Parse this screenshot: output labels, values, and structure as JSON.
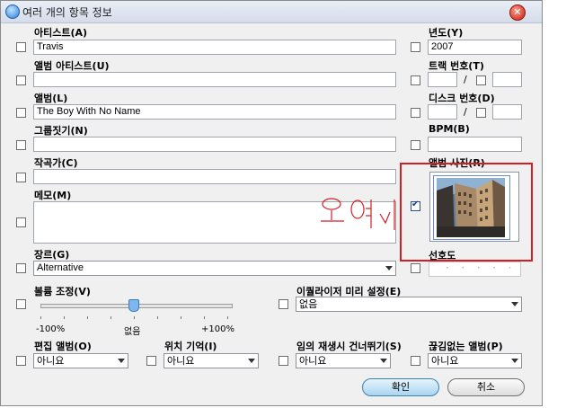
{
  "window": {
    "title": "여러 개의 항목 정보",
    "close_glyph": "✕"
  },
  "fields": {
    "artist": {
      "label": "아티스트(A)",
      "value": "Travis"
    },
    "year": {
      "label": "년도(Y)",
      "value": "2007"
    },
    "album_artist": {
      "label": "앨범 아티스트(U)",
      "value": ""
    },
    "track_number": {
      "label": "트랙 번호(T)",
      "value": "",
      "of": "/"
    },
    "album": {
      "label": "앨범(L)",
      "value": "The Boy With No Name"
    },
    "disc_number": {
      "label": "디스크 번호(D)",
      "value": "",
      "of": "/"
    },
    "grouping": {
      "label": "그룹짓기(N)",
      "value": ""
    },
    "bpm": {
      "label": "BPM(B)",
      "value": ""
    },
    "composer": {
      "label": "작곡가(C)",
      "value": ""
    },
    "artwork": {
      "label": "앨범 사진(R)"
    },
    "comments": {
      "label": "메모(M)",
      "value": ""
    },
    "genre": {
      "label": "장르(G)",
      "value": "Alternative"
    },
    "rating": {
      "label": "선호도",
      "stars": "• • • • •"
    },
    "volume": {
      "label": "볼륨 조정(V)",
      "min": "-100%",
      "mid": "없음",
      "max": "+100%",
      "value_percent": 0
    },
    "equalizer": {
      "label": "이퀄라이저 미리 설정(E)",
      "value": "없음"
    },
    "compilation": {
      "label": "편집 앨범(O)",
      "value": "아니요"
    },
    "remember_position": {
      "label": "위치 기억(I)",
      "value": "아니요"
    },
    "skip_shuffle": {
      "label": "임의 재생시 건너뛰기(S)",
      "value": "아니요"
    },
    "gapless": {
      "label": "끊김없는 앨범(P)",
      "value": "아니요"
    }
  },
  "buttons": {
    "ok": "확인",
    "cancel": "취소"
  },
  "annotation": {
    "color": "#d21f26"
  }
}
